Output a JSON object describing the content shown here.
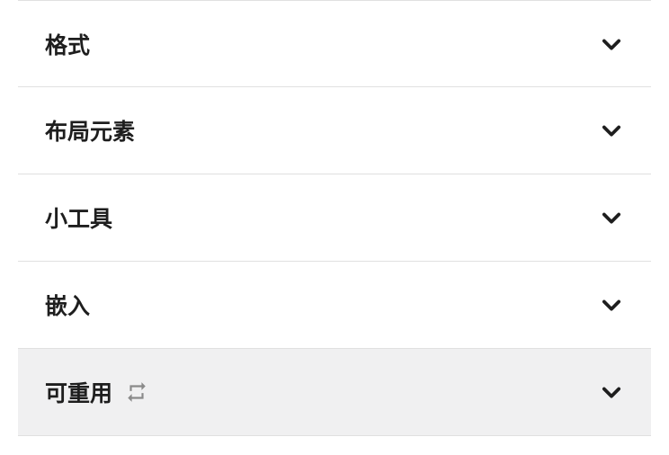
{
  "panels": [
    {
      "label": "格式",
      "hasIcon": false,
      "highlighted": false
    },
    {
      "label": "布局元素",
      "hasIcon": false,
      "highlighted": false
    },
    {
      "label": "小工具",
      "hasIcon": false,
      "highlighted": false
    },
    {
      "label": "嵌入",
      "hasIcon": false,
      "highlighted": false
    },
    {
      "label": "可重用",
      "hasIcon": true,
      "highlighted": true
    }
  ]
}
